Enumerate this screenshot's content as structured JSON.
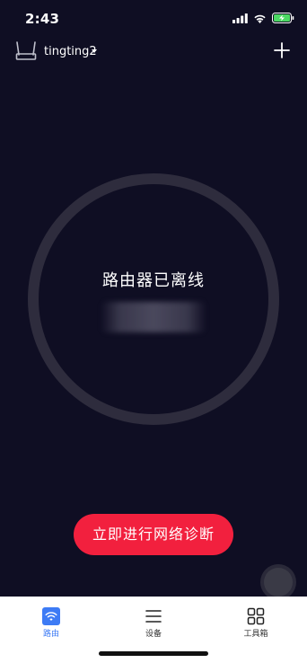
{
  "status_bar": {
    "time": "2:43",
    "icons": [
      "signal-icon",
      "wifi-icon",
      "battery-charging-icon"
    ],
    "battery_color": "#4cd964"
  },
  "header": {
    "router_name": "tingting2",
    "router_icon": "router-icon",
    "add_icon": "plus-icon"
  },
  "status": {
    "title": "路由器已离线",
    "ring_color": "#2e2c3d"
  },
  "diagnose_button": {
    "label": "立即进行网络诊断",
    "color": "#f2203e"
  },
  "tabs": [
    {
      "label": "路由",
      "icon": "wifi-tab-icon",
      "active": true
    },
    {
      "label": "设备",
      "icon": "menu-lines-icon",
      "active": false
    },
    {
      "label": "工具箱",
      "icon": "grid-icon",
      "active": false
    }
  ],
  "colors": {
    "background": "#0f0e23",
    "accent": "#3d7bf5",
    "tab_bar": "#ffffff"
  }
}
